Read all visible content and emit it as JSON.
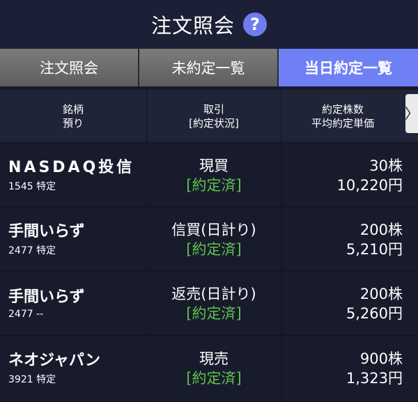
{
  "header": {
    "title": "注文照会",
    "help_glyph": "?"
  },
  "tabs": [
    {
      "label": "注文照会",
      "active": false
    },
    {
      "label": "未約定一覧",
      "active": false
    },
    {
      "label": "当日約定一覧",
      "active": true
    }
  ],
  "columns": {
    "col1": [
      "銘柄",
      "預り"
    ],
    "col2": [
      "取引",
      "[約定状況]"
    ],
    "col3": [
      "約定株数",
      "平均約定単価"
    ],
    "scroll_glyph": "〉"
  },
  "rows": [
    {
      "name": "NASDAQ投信",
      "sub": "1545 特定",
      "type": "現買",
      "status": "[約定済]",
      "qty": "30株",
      "price": "10,220円"
    },
    {
      "name": "手間いらず",
      "sub": "2477 特定",
      "type": "信買(日計り)",
      "status": "[約定済]",
      "qty": "200株",
      "price": "5,210円"
    },
    {
      "name": "手間いらず",
      "sub": "2477 --",
      "type": "返売(日計り)",
      "status": "[約定済]",
      "qty": "200株",
      "price": "5,260円"
    },
    {
      "name": "ネオジャパン",
      "sub": "3921 特定",
      "type": "現売",
      "status": "[約定済]",
      "qty": "900株",
      "price": "1,323円"
    }
  ],
  "colors": {
    "accent": "#6f80f5",
    "status_green": "#5cc54a",
    "background": "#171a2b"
  }
}
